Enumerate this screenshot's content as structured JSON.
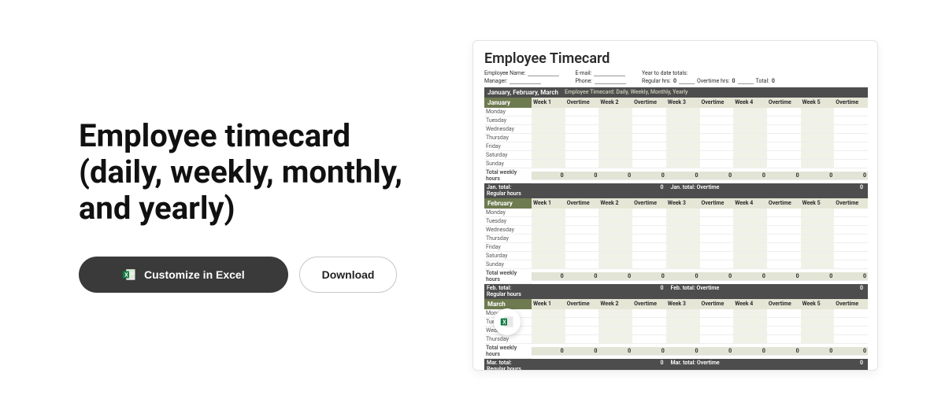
{
  "title": "Employee timecard (daily, weekly, monthly, and yearly)",
  "buttons": {
    "customize": "Customize in Excel",
    "download": "Download"
  },
  "preview": {
    "title": "Employee Timecard",
    "fields": {
      "employee_name_label": "Employee Name:",
      "manager_label": "Manager:",
      "email_label": "E-mail:",
      "phone_label": "Phone:",
      "ytd_label": "Year to date totals:",
      "regular_hrs_label": "Regular hrs:",
      "regular_hrs_value": "0",
      "overtime_hrs_label": "Overtime hrs:",
      "overtime_hrs_value": "0",
      "total_label": "Total:",
      "total_value": "0"
    },
    "band": {
      "title": "January, February, March",
      "subtitle": "Employee Timecard: Daily, Weekly, Monthly, Yearly"
    },
    "columns": {
      "week_pairs": [
        {
          "w": "Week 1",
          "o": "Overtime"
        },
        {
          "w": "Week 2",
          "o": "Overtime"
        },
        {
          "w": "Week 3",
          "o": "Overtime"
        },
        {
          "w": "Week 4",
          "o": "Overtime"
        },
        {
          "w": "Week 5",
          "o": "Overtime"
        }
      ]
    },
    "days": [
      "Monday",
      "Tuesday",
      "Wednesday",
      "Thursday",
      "Friday",
      "Saturday",
      "Sunday"
    ],
    "total_weekly_label": "Total weekly hours",
    "zero": "0",
    "months": [
      {
        "name": "January",
        "reg_label": "Jan. total: Regular hours",
        "ot_label": "Jan. total: Overtime"
      },
      {
        "name": "February",
        "reg_label": "Feb. total: Regular hours",
        "ot_label": "Feb. total: Overtime"
      },
      {
        "name": "March",
        "reg_label": "Mar. total: Regular hours",
        "ot_label": "Mar. total: Overtime"
      }
    ]
  }
}
